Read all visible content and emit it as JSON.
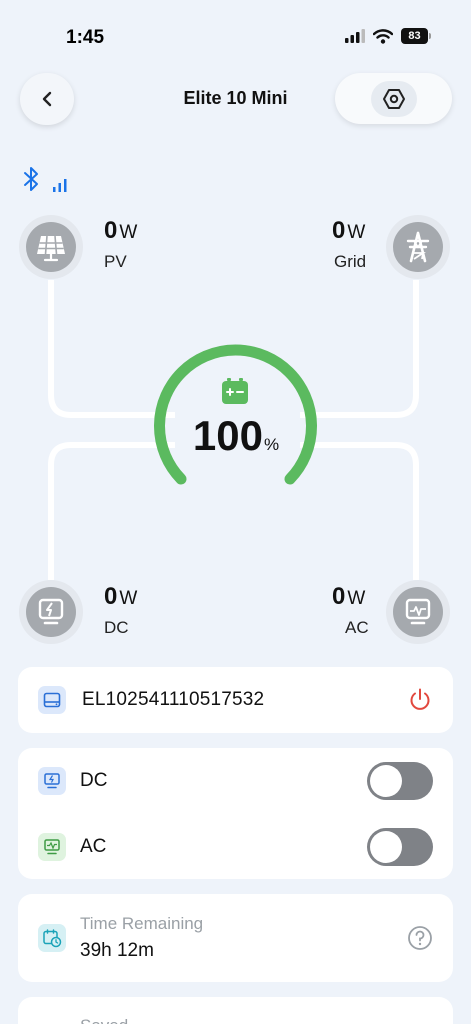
{
  "status_bar": {
    "time": "1:45",
    "battery": "83"
  },
  "header": {
    "title": "Elite 10 Mini"
  },
  "connection": {
    "bluetooth_icon": "bluetooth-icon",
    "signal_icon": "signal-bars-icon"
  },
  "flow": {
    "pv": {
      "value": "0",
      "unit": "W",
      "label": "PV"
    },
    "grid": {
      "value": "0",
      "unit": "W",
      "label": "Grid"
    },
    "dc": {
      "value": "0",
      "unit": "W",
      "label": "DC"
    },
    "ac": {
      "value": "0",
      "unit": "W",
      "label": "AC"
    },
    "battery": {
      "value": "100",
      "unit": "%",
      "level": 1.0
    }
  },
  "device": {
    "serial": "EL102541110517532"
  },
  "outputs": {
    "dc": {
      "label": "DC",
      "enabled": false
    },
    "ac": {
      "label": "AC",
      "enabled": false
    }
  },
  "time_remaining": {
    "label": "Time Remaining",
    "value": "39h 12m"
  },
  "saved": {
    "label": "Saved"
  },
  "colors": {
    "accent_green": "#5bba5f",
    "power_red": "#e2483e",
    "blue": "#1a73e8",
    "toggle_off": "#7f8287"
  }
}
